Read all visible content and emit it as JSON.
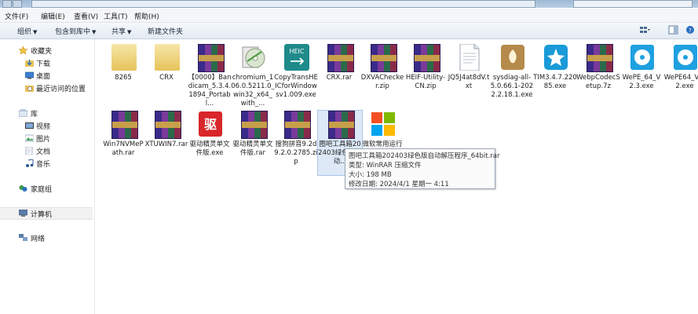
{
  "menu": [
    "文件(F)",
    "编辑(E)",
    "查看(V)",
    "工具(T)",
    "帮助(H)"
  ],
  "toolbar": {
    "organize": "组织",
    "include_in_library": "包含到库中",
    "share": "共享",
    "new_folder": "新建文件夹"
  },
  "sidebar": {
    "favorites": "收藏夹",
    "favorites_items": [
      "下载",
      "桌面",
      "最近访问的位置"
    ],
    "libraries": "库",
    "library_items": [
      "视频",
      "图片",
      "文档",
      "音乐"
    ],
    "homegroup": "家庭组",
    "computer": "计算机",
    "network": "网络"
  },
  "files": [
    {
      "name": "8265",
      "icon": "folder"
    },
    {
      "name": "CRX",
      "icon": "folder"
    },
    {
      "name": "【0000】Bandicam_5.3.4.1894_Portabl...",
      "icon": "rar"
    },
    {
      "name": "chromium_106.0.5211.0_win32_x64_with_...",
      "icon": "disc-installer"
    },
    {
      "name": "CopyTransHEICforWindowsv1.009.exe",
      "icon": "heic"
    },
    {
      "name": "CRX.rar",
      "icon": "rar"
    },
    {
      "name": "DXVAChecker.zip",
      "icon": "rar"
    },
    {
      "name": "HEIF-Utility-CN.zip",
      "icon": "rar"
    },
    {
      "name": "JQ5J4at8dV.txt",
      "icon": "text-file"
    },
    {
      "name": "sysdiag-all-5.0.66.1-2022.2.18.1.exe",
      "icon": "shield-app"
    },
    {
      "name": "TIM3.4.7.22085.exe",
      "icon": "tim-star"
    },
    {
      "name": "WebpCodecSetup.7z",
      "icon": "rar"
    },
    {
      "name": "WePE_64_V2.3.exe",
      "icon": "cd-installer"
    },
    {
      "name": "WePE64_V2.2.exe",
      "icon": "cd-installer"
    },
    {
      "name": "Win7NVMePath.rar",
      "icon": "rar"
    },
    {
      "name": "XTUWIN7.rar",
      "icon": "rar"
    },
    {
      "name": "驱动精灵单文件版.exe",
      "icon": "driver-app"
    },
    {
      "name": "驱动精灵单文件版.rar",
      "icon": "rar"
    },
    {
      "name": "搜狗拼音9.2d9.2.0.2785.zip",
      "icon": "rar"
    },
    {
      "name": "图吧工具箱202403绿色版自动...",
      "icon": "rar"
    },
    {
      "name": "微软常用运行库合集...",
      "icon": "windows-logo"
    }
  ],
  "tooltip": {
    "title": "图吧工具箱202403绿色版自动解压程序_64bit.rar",
    "type": "类型: WinRAR 压缩文件",
    "size": "大小: 198 MB",
    "modified": "修改日期: 2024/4/1 星期一 4:11"
  },
  "colors": {
    "accent": "#1e6fb8",
    "toolbar_bg": "#e4ebf3",
    "selection": "#dde9f7"
  }
}
